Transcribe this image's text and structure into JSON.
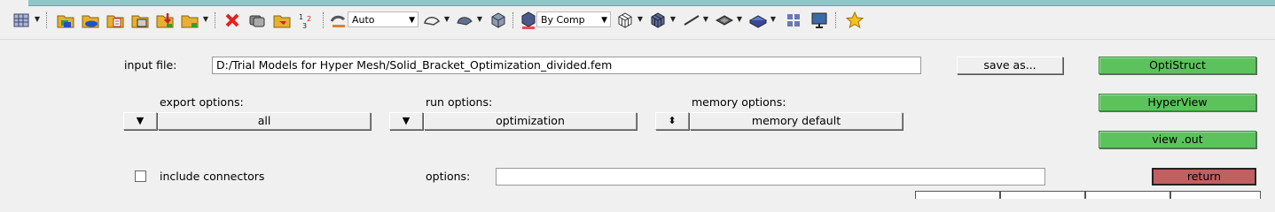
{
  "toolbar": {
    "auto_select": "Auto",
    "by_comp_select": "By Comp",
    "icons": [
      "grid-icon",
      "open-model-icon",
      "import-icon",
      "save-icon",
      "open-folder-icon",
      "load-script-icon",
      "import-red-arrow-icon",
      "export-folder-icon",
      "delete-icon",
      "display-icon",
      "mask-folder-icon",
      "number-icon",
      "view-mode-icon",
      "shading-icon",
      "surface-icon",
      "solid-icon",
      "by-comp-icon",
      "wireframe-icon",
      "shaded-elements-icon",
      "line-icon",
      "layers-icon",
      "plane-icon",
      "tile-icon",
      "monitor-icon",
      "favorites-star-icon"
    ]
  },
  "form": {
    "input_file_label": "input file:",
    "input_file_value": "D:/Trial Models for Hyper Mesh/Solid_Bracket_Optimization_divided.fem",
    "save_as_label": "save as...",
    "export_options_label": "export options:",
    "export_options_value": "all",
    "run_options_label": "run options:",
    "run_options_value": "optimization",
    "memory_options_label": "memory options:",
    "memory_options_value": "memory default",
    "include_connectors_label": "include connectors",
    "options_label": "options:",
    "options_value": ""
  },
  "actions": {
    "optistruct": "OptiStruct",
    "hyperview": "HyperView",
    "view_out": "view .out",
    "return": "return"
  },
  "colors": {
    "green_button": "#5cc35c",
    "red_button": "#c06060",
    "panel_bg": "#f0f0f0"
  }
}
